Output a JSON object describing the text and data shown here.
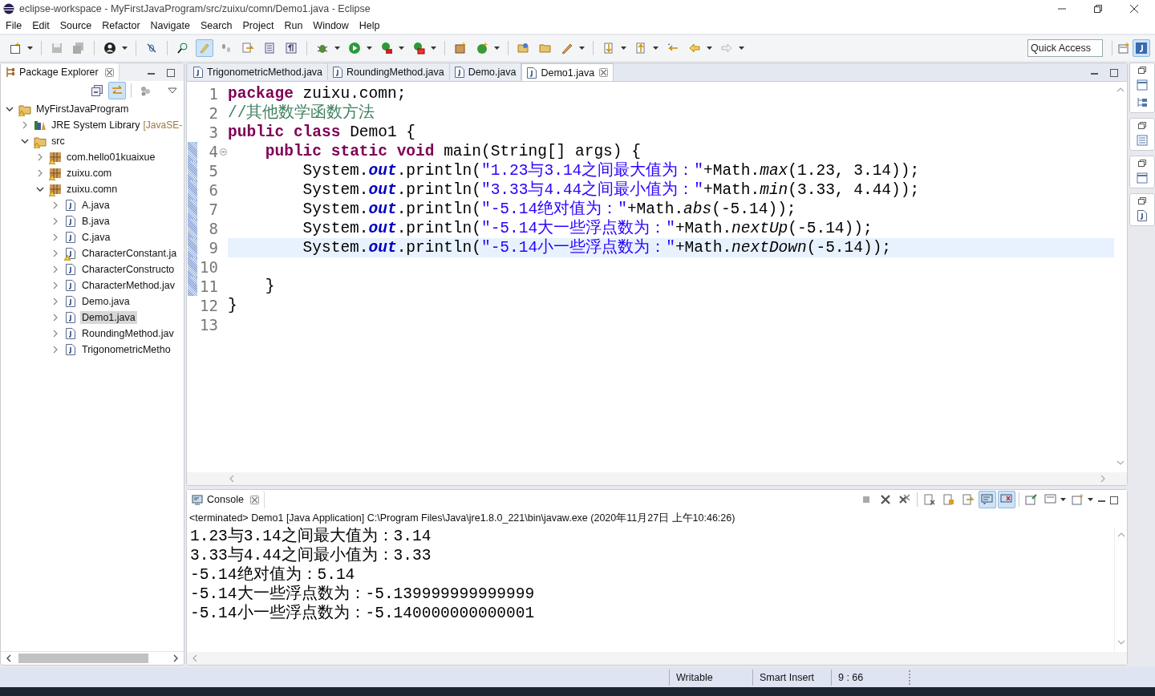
{
  "window": {
    "title": "eclipse-workspace - MyFirstJavaProgram/src/zuixu/comn/Demo1.java - Eclipse"
  },
  "menu": [
    "File",
    "Edit",
    "Source",
    "Refactor",
    "Navigate",
    "Search",
    "Project",
    "Run",
    "Window",
    "Help"
  ],
  "toolbar": {
    "quick_access": {
      "placeholder": "Quick Access"
    }
  },
  "package_explorer": {
    "title": "Package Explorer",
    "tree": [
      {
        "label": "MyFirstJavaProgram",
        "kind": "project",
        "warning": true,
        "expanded": true,
        "selected": false,
        "children": [
          {
            "label": "JRE System Library",
            "decoration": "[JavaSE-",
            "kind": "library",
            "warning": false,
            "expanded": false,
            "selected": false
          },
          {
            "label": "src",
            "kind": "source",
            "warning": true,
            "expanded": true,
            "selected": false,
            "children": [
              {
                "label": "com.hello01kuaixue",
                "kind": "package",
                "warning": true,
                "expanded": false,
                "selected": false
              },
              {
                "label": "zuixu.com",
                "kind": "package",
                "warning": true,
                "expanded": false,
                "selected": false
              },
              {
                "label": "zuixu.comn",
                "kind": "package",
                "warning": true,
                "expanded": true,
                "selected": false,
                "children": [
                  {
                    "label": "A.java",
                    "kind": "java",
                    "warning": false,
                    "expanded": false,
                    "selected": false
                  },
                  {
                    "label": "B.java",
                    "kind": "java",
                    "warning": false,
                    "expanded": false,
                    "selected": false
                  },
                  {
                    "label": "C.java",
                    "kind": "java",
                    "warning": false,
                    "expanded": false,
                    "selected": false
                  },
                  {
                    "label": "CharacterConstant.ja",
                    "kind": "java",
                    "warning": true,
                    "expanded": false,
                    "selected": false
                  },
                  {
                    "label": "CharacterConstructo",
                    "kind": "java",
                    "warning": false,
                    "expanded": false,
                    "selected": false
                  },
                  {
                    "label": "CharacterMethod.jav",
                    "kind": "java",
                    "warning": false,
                    "expanded": false,
                    "selected": false
                  },
                  {
                    "label": "Demo.java",
                    "kind": "java",
                    "warning": false,
                    "expanded": false,
                    "selected": false
                  },
                  {
                    "label": "Demo1.java",
                    "kind": "java",
                    "warning": false,
                    "expanded": false,
                    "selected": true
                  },
                  {
                    "label": "RoundingMethod.jav",
                    "kind": "java",
                    "warning": false,
                    "expanded": false,
                    "selected": false
                  },
                  {
                    "label": "TrigonometricMetho",
                    "kind": "java",
                    "warning": false,
                    "expanded": false,
                    "selected": false
                  }
                ]
              }
            ]
          }
        ]
      }
    ]
  },
  "editor": {
    "tabs": [
      {
        "label": "TrigonometricMethod.java",
        "selected": false
      },
      {
        "label": "RoundingMethod.java",
        "selected": false
      },
      {
        "label": "Demo.java",
        "selected": false
      },
      {
        "label": "Demo1.java",
        "selected": true
      }
    ],
    "lines": [
      {
        "number": "1",
        "changed": false,
        "current": false,
        "foldable": false,
        "tokens": [
          {
            "kind": "keyword",
            "text": "package"
          },
          {
            "kind": "plain",
            "text": " zuixu.comn;"
          }
        ]
      },
      {
        "number": "2",
        "changed": false,
        "current": false,
        "foldable": false,
        "tokens": [
          {
            "kind": "comment",
            "text": "//其他数学函数方法"
          }
        ]
      },
      {
        "number": "3",
        "changed": false,
        "current": false,
        "foldable": false,
        "tokens": [
          {
            "kind": "keyword",
            "text": "public"
          },
          {
            "kind": "keyword",
            "text": " class"
          },
          {
            "kind": "plain",
            "text": " Demo1 {"
          }
        ]
      },
      {
        "number": "4",
        "changed": true,
        "current": false,
        "foldable": true,
        "tokens": [
          {
            "kind": "keyword",
            "text": "    public"
          },
          {
            "kind": "keyword",
            "text": " static"
          },
          {
            "kind": "keyword",
            "text": " void"
          },
          {
            "kind": "plain",
            "text": " main(String[] args) {"
          }
        ]
      },
      {
        "number": "5",
        "changed": true,
        "current": false,
        "foldable": false,
        "tokens": [
          {
            "kind": "plain",
            "text": "        System."
          },
          {
            "kind": "field",
            "text": "out"
          },
          {
            "kind": "plain",
            "text": ".println("
          },
          {
            "kind": "string",
            "text": "\"1.23与3.14之间最大值为：\""
          },
          {
            "kind": "plain",
            "text": "+Math."
          },
          {
            "kind": "static_method",
            "text": "max"
          },
          {
            "kind": "plain",
            "text": "(1.23, 3.14));"
          }
        ]
      },
      {
        "number": "6",
        "changed": true,
        "current": false,
        "foldable": false,
        "tokens": [
          {
            "kind": "plain",
            "text": "        System."
          },
          {
            "kind": "field",
            "text": "out"
          },
          {
            "kind": "plain",
            "text": ".println("
          },
          {
            "kind": "string",
            "text": "\"3.33与4.44之间最小值为：\""
          },
          {
            "kind": "plain",
            "text": "+Math."
          },
          {
            "kind": "static_method",
            "text": "min"
          },
          {
            "kind": "plain",
            "text": "(3.33, 4.44));"
          }
        ]
      },
      {
        "number": "7",
        "changed": true,
        "current": false,
        "foldable": false,
        "tokens": [
          {
            "kind": "plain",
            "text": "        System."
          },
          {
            "kind": "field",
            "text": "out"
          },
          {
            "kind": "plain",
            "text": ".println("
          },
          {
            "kind": "string",
            "text": "\"-5.14绝对值为：\""
          },
          {
            "kind": "plain",
            "text": "+Math."
          },
          {
            "kind": "static_method",
            "text": "abs"
          },
          {
            "kind": "plain",
            "text": "(-5.14));"
          }
        ]
      },
      {
        "number": "8",
        "changed": true,
        "current": false,
        "foldable": false,
        "tokens": [
          {
            "kind": "plain",
            "text": "        System."
          },
          {
            "kind": "field",
            "text": "out"
          },
          {
            "kind": "plain",
            "text": ".println("
          },
          {
            "kind": "string",
            "text": "\"-5.14大一些浮点数为：\""
          },
          {
            "kind": "plain",
            "text": "+Math."
          },
          {
            "kind": "static_method",
            "text": "nextUp"
          },
          {
            "kind": "plain",
            "text": "(-5.14));"
          }
        ]
      },
      {
        "number": "9",
        "changed": true,
        "current": true,
        "foldable": false,
        "tokens": [
          {
            "kind": "plain",
            "text": "        System."
          },
          {
            "kind": "field",
            "text": "out"
          },
          {
            "kind": "plain",
            "text": ".println("
          },
          {
            "kind": "string",
            "text": "\"-5.14小一些浮点数为：\""
          },
          {
            "kind": "plain",
            "text": "+Math."
          },
          {
            "kind": "static_method",
            "text": "nextDown"
          },
          {
            "kind": "plain",
            "text": "(-5.14));"
          }
        ]
      },
      {
        "number": "10",
        "changed": true,
        "current": false,
        "foldable": false
      },
      {
        "number": "11",
        "changed": true,
        "current": false,
        "foldable": false,
        "tokens": [
          {
            "kind": "plain",
            "text": "    }"
          }
        ]
      },
      {
        "number": "12",
        "changed": false,
        "current": false,
        "foldable": false,
        "tokens": [
          {
            "kind": "plain",
            "text": "}"
          }
        ]
      },
      {
        "number": "13",
        "changed": false,
        "current": false,
        "foldable": false
      }
    ]
  },
  "console": {
    "title": "Console",
    "description": "<terminated> Demo1 [Java Application] C:\\Program Files\\Java\\jre1.8.0_221\\bin\\javaw.exe (2020年11月27日 上午10:46:26)",
    "output": [
      "1.23与3.14之间最大值为：3.14",
      "3.33与4.44之间最小值为：3.33",
      "-5.14绝对值为：5.14",
      "-5.14大一些浮点数为：-5.139999999999999",
      "-5.14小一些浮点数为：-5.140000000000001"
    ]
  },
  "status_bar": {
    "items": [
      "Writable",
      "Smart Insert",
      "9 : 66"
    ]
  }
}
